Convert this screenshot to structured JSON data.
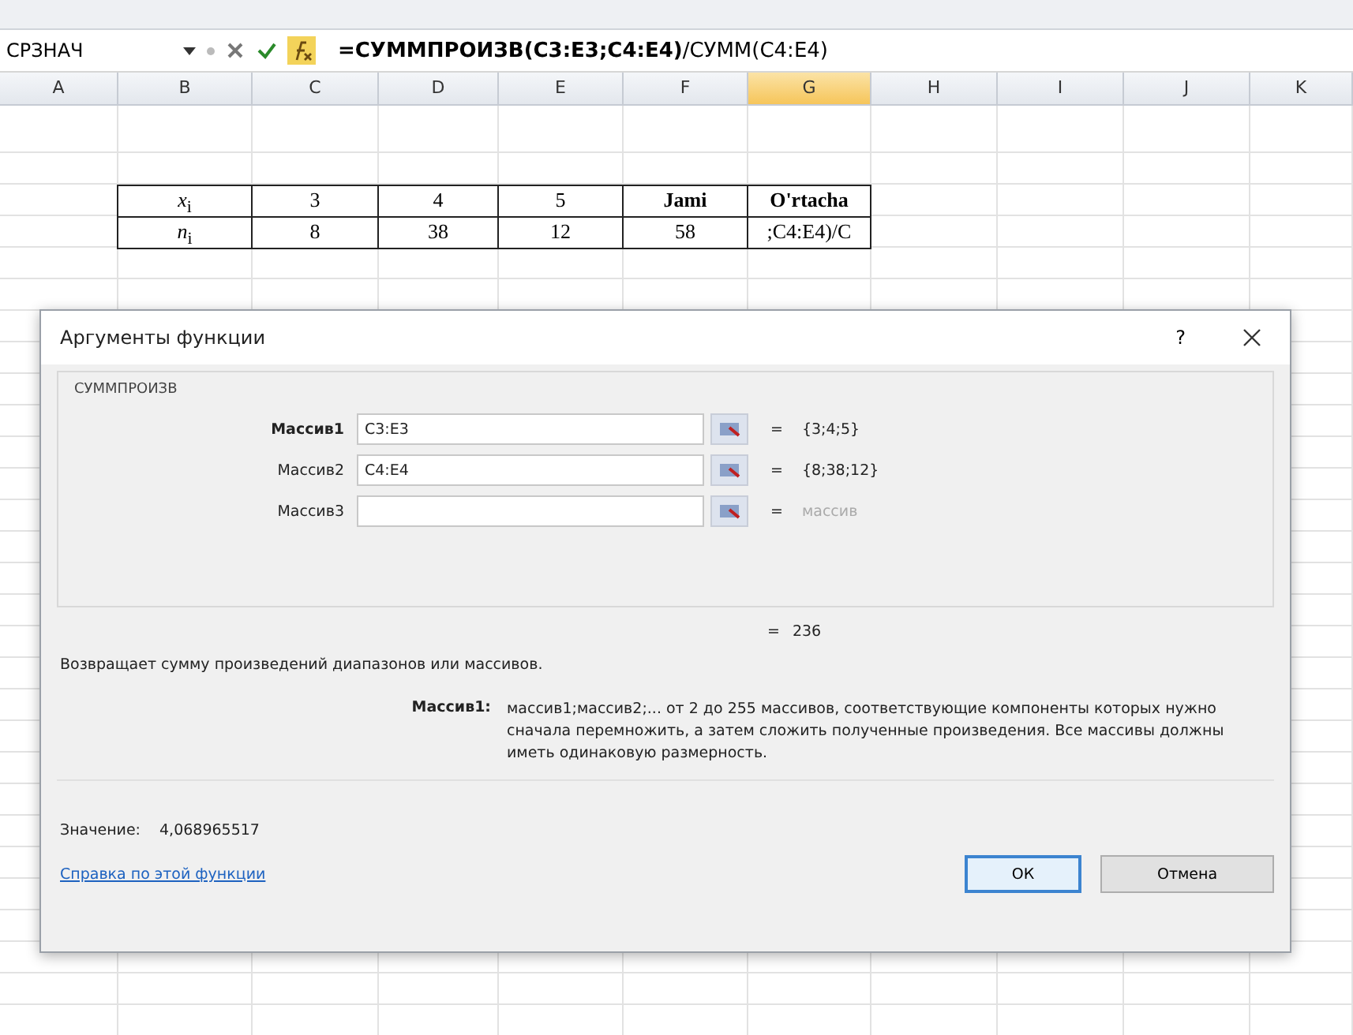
{
  "name_box": {
    "value": "СРЗНАЧ"
  },
  "formula_bar": {
    "formula": "**=СУММПРОИЗВ(C3:E3;C4:E4)**/СУММ(C4:E4)"
  },
  "columns": [
    {
      "label": "A",
      "selected": false
    },
    {
      "label": "B",
      "selected": false
    },
    {
      "label": "C",
      "selected": false
    },
    {
      "label": "D",
      "selected": false
    },
    {
      "label": "E",
      "selected": false
    },
    {
      "label": "F",
      "selected": false
    },
    {
      "label": "G",
      "selected": true
    },
    {
      "label": "H",
      "selected": false
    },
    {
      "label": "I",
      "selected": false
    },
    {
      "label": "J",
      "selected": false
    },
    {
      "label": "K",
      "selected": false
    }
  ],
  "table": {
    "rows": [
      [
        {
          "text": "*x*$_{i}$",
          "bold": false
        },
        {
          "text": "3",
          "bold": false
        },
        {
          "text": "4",
          "bold": false
        },
        {
          "text": "5",
          "bold": false
        },
        {
          "text": "Jami",
          "bold": true
        },
        {
          "text": "O'rtacha",
          "bold": true
        }
      ],
      [
        {
          "text": "*n*$_{i}$",
          "bold": false
        },
        {
          "text": "8",
          "bold": false
        },
        {
          "text": "38",
          "bold": false
        },
        {
          "text": "12",
          "bold": false
        },
        {
          "text": "58",
          "bold": false
        },
        {
          "text": ";C4:E4)/C",
          "bold": false
        }
      ]
    ]
  },
  "dialog": {
    "title": "Аргументы функции",
    "help": "?",
    "function_name": "СУММПРОИЗВ",
    "arguments": [
      {
        "label": "Массив1",
        "value": "C3:E3",
        "equals": "=",
        "result": "{3;4;5}",
        "active": true,
        "filled": true
      },
      {
        "label": "Массив2",
        "value": "C4:E4",
        "equals": "=",
        "result": "{8;38;12}",
        "active": false,
        "filled": true
      },
      {
        "label": "Массив3",
        "equals": "=",
        "result": "массив",
        "active": false,
        "filled": false
      }
    ],
    "total": {
      "equals": "=",
      "value": "236"
    },
    "description": "Возвращает сумму произведений диапазонов или массивов.",
    "argument_help": {
      "label": "Массив1:",
      "text": "массив1;массив2;... от 2 до 255 массивов, соответствующие компоненты которых нужно сначала перемножить, а затем сложить полученные произведения. Все массивы должны иметь одинаковую размерность."
    },
    "value": {
      "label": "Значение:",
      "value": "4,068965517"
    },
    "help_link": "Справка по этой функции",
    "buttons": [
      {
        "label": "ОК",
        "default": true
      },
      {
        "label": "Отмена",
        "default": false
      }
    ]
  }
}
